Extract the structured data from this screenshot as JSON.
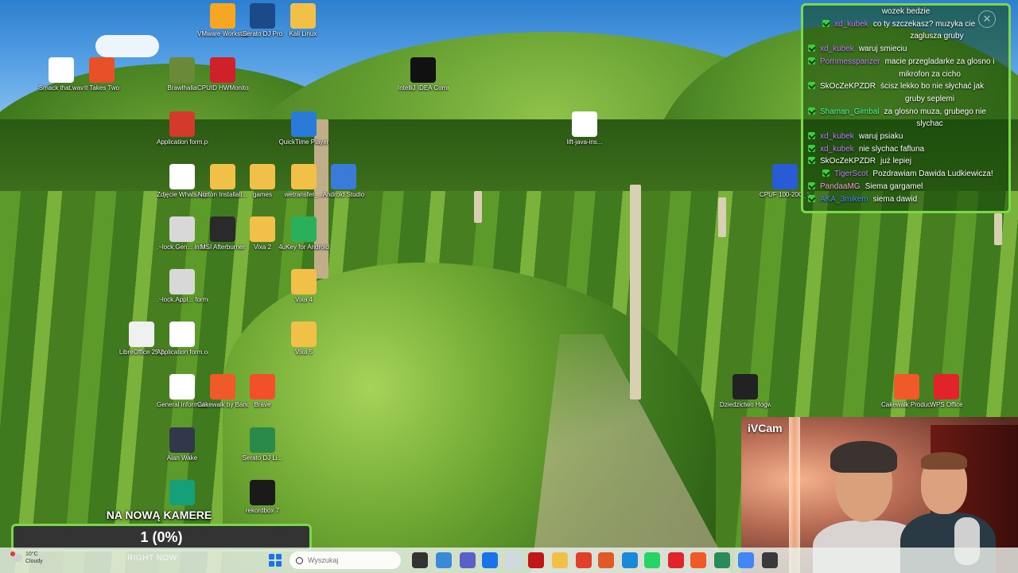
{
  "desktop": {
    "icons": [
      {
        "label": "VMware Workstati...",
        "icon": "vmware-icon",
        "color": "#f5a623"
      },
      {
        "label": "Serato DJ Pro",
        "icon": "serato-icon",
        "color": "#1a4a8a"
      },
      {
        "label": "Kali Linux",
        "icon": "folder-icon",
        "color": "#f0c048"
      },
      {
        "label": "Smack that.wav",
        "icon": "audio-file-icon",
        "color": "#ffffff"
      },
      {
        "label": "It Takes Two",
        "icon": "game-icon",
        "color": "#e8502a"
      },
      {
        "label": "Brawlhalla",
        "icon": "game-icon",
        "color": "#6a8a3a"
      },
      {
        "label": "CPUID HWMonitor",
        "icon": "hwmonitor-icon",
        "color": "#d0202a"
      },
      {
        "label": "IntelliJ IDEA Communi...",
        "icon": "intellij-icon",
        "color": "#111111"
      },
      {
        "label": "lift-java-ins...",
        "icon": "installer-icon",
        "color": "#ffffff"
      },
      {
        "label": "Application form.pdf",
        "icon": "pdf-icon",
        "color": "#d23b2c"
      },
      {
        "label": "QuickTime Player",
        "icon": "quicktime-icon",
        "color": "#2a7ad8"
      },
      {
        "label": "Zdjęcie WhatsApp...",
        "icon": "image-file-icon",
        "color": "#ffffff"
      },
      {
        "label": "Norton Installati...",
        "icon": "folder-icon",
        "color": "#f0c048"
      },
      {
        "label": "games",
        "icon": "folder-icon",
        "color": "#f0c048"
      },
      {
        "label": "wetransfer_...",
        "icon": "folder-icon",
        "color": "#f0c048"
      },
      {
        "label": "Android Studio",
        "icon": "android-studio-icon",
        "color": "#3a7ad8"
      },
      {
        "label": "CPUF 100-20C_S...",
        "icon": "word-doc-icon",
        "color": "#2a5bd7"
      },
      {
        "label": ".~lock.Gen... informatio...",
        "icon": "lock-file-icon",
        "color": "#d8d8d8"
      },
      {
        "label": "MSI Afterburner",
        "icon": "msi-afterburner-icon",
        "color": "#2a2a2a"
      },
      {
        "label": "Vixa 2",
        "icon": "folder-icon",
        "color": "#f0c048"
      },
      {
        "label": "4uKey for Android",
        "icon": "4ukey-icon",
        "color": "#2ab05a"
      },
      {
        "label": ".~lock.Appl... form.odg#",
        "icon": "lock-file-icon",
        "color": "#d8d8d8"
      },
      {
        "label": "Vixa 4",
        "icon": "folder-image-icon",
        "color": "#f0c048"
      },
      {
        "label": "LibreOffice 25.2",
        "icon": "libreoffice-icon",
        "color": "#f0f0f0"
      },
      {
        "label": "Application form.odg",
        "icon": "odg-file-icon",
        "color": "#ffffff"
      },
      {
        "label": "Vixa 5",
        "icon": "folder-image-icon",
        "color": "#f0c048"
      },
      {
        "label": "Dziedzictwo Hogwartu (3)",
        "icon": "hogwarts-icon",
        "color": "#222222"
      },
      {
        "label": "Cakewalk Produc...",
        "icon": "cakewalk-icon",
        "color": "#f05a28"
      },
      {
        "label": "WPS Office",
        "icon": "wps-icon",
        "color": "#e0242a"
      },
      {
        "label": "General informatio...",
        "icon": "document-icon",
        "color": "#ffffff"
      },
      {
        "label": "Cakewalk by BandLab",
        "icon": "cakewalk-icon",
        "color": "#f05a28"
      },
      {
        "label": "Brave",
        "icon": "brave-icon",
        "color": "#f0502a"
      },
      {
        "label": "Alan Wake",
        "icon": "game-icon",
        "color": "#30384a"
      },
      {
        "label": "Serato DJ Li...",
        "icon": "serato-icon",
        "color": "#2a8a4a"
      },
      {
        "label": "rekordbox 7",
        "icon": "rekordbox-icon",
        "color": "#1a1a1a"
      },
      {
        "label": "",
        "icon": "grammarly-icon",
        "color": "#15a07a"
      }
    ]
  },
  "chat": {
    "lines": [
      {
        "user": "",
        "msg": "wozek bedzie",
        "user_color": "#ffffff",
        "badge": false,
        "indent": false
      },
      {
        "user": "xd_kubek",
        "msg": "co ty szczekasz? muzyka cie",
        "cont": "zaglusza gruby",
        "user_color": "#c47aff",
        "badge": true,
        "indent": true
      },
      {
        "user": "xd_kubek",
        "msg": "waruj smieciu",
        "user_color": "#c47aff",
        "badge": true,
        "indent": false
      },
      {
        "user": "Pornmesspanzer",
        "msg": "macie przegladarke za glosno i",
        "cont": "mikrofon za cicho",
        "user_color": "#c47aff",
        "badge": true,
        "indent": false
      },
      {
        "user": "SkOcZeKPZDR",
        "msg": "ścisz lekko bo nie słychać jak",
        "cont": "gruby seplemi",
        "user_color": "#ffffff",
        "badge": true,
        "indent": false
      },
      {
        "user": "Shaman_Gimbal",
        "msg": "za glosno muza, grubego nie",
        "cont": "slychac",
        "user_color": "#4aff9a",
        "badge": true,
        "indent": false
      },
      {
        "user": "xd_kubek",
        "msg": "waruj psiaku",
        "user_color": "#c47aff",
        "badge": true,
        "indent": false
      },
      {
        "user": "xd_kubek",
        "msg": "nie slychac fafluna",
        "user_color": "#c47aff",
        "badge": true,
        "indent": false
      },
      {
        "user": "SkOcZeKPZDR",
        "msg": "już lepiej",
        "user_color": "#ffffff",
        "badge": true,
        "indent": false
      },
      {
        "user": "TigerScot",
        "msg": "Pozdrawiam Dawida Ludkiewicza!",
        "user_color": "#c47aff",
        "badge": true,
        "indent": true
      },
      {
        "user": "PandaaMG",
        "msg": "Siema gargamel",
        "user_color": "#ff9ae0",
        "badge": true,
        "indent": false
      },
      {
        "user": "AKA_3mikem",
        "msg": "siema dawid",
        "user_color": "#4a8aff",
        "badge": true,
        "indent": false
      }
    ],
    "close_icon": "close-icon"
  },
  "webcam": {
    "label": "iVCam"
  },
  "goal": {
    "title": "NA NOWĄ KAMERE",
    "value_text": "1 (0%)",
    "progress": 0.0,
    "accent": "#7ad84a"
  },
  "taskbar": {
    "weather": {
      "temp": "10°C",
      "condition": "Cloudy"
    },
    "right_now": "RIGHT NOW",
    "search_placeholder": "Wyszukaj",
    "apps": [
      {
        "icon": "task-view-icon",
        "color": "#333333"
      },
      {
        "icon": "copilot-icon",
        "color": "#3a8ad8"
      },
      {
        "icon": "teams-icon",
        "color": "#5b5fc7"
      },
      {
        "icon": "store-icon",
        "color": "#1a73e8"
      },
      {
        "icon": "notepad-icon",
        "color": "#d0d8e0"
      },
      {
        "icon": "mcafee-icon",
        "color": "#c01818"
      },
      {
        "icon": "file-explorer-icon",
        "color": "#f0c048"
      },
      {
        "icon": "browser-icon",
        "color": "#e0402a"
      },
      {
        "icon": "app-icon",
        "color": "#e05a28"
      },
      {
        "icon": "app-icon",
        "color": "#1a8ad8"
      },
      {
        "icon": "whatsapp-icon",
        "color": "#25d366"
      },
      {
        "icon": "wps-icon",
        "color": "#e0242a"
      },
      {
        "icon": "app-icon",
        "color": "#f05a28"
      },
      {
        "icon": "app-icon",
        "color": "#2a8a5a"
      },
      {
        "icon": "chrome-icon",
        "color": "#4285f4"
      },
      {
        "icon": "app-icon",
        "color": "#3a3a3a"
      }
    ]
  }
}
